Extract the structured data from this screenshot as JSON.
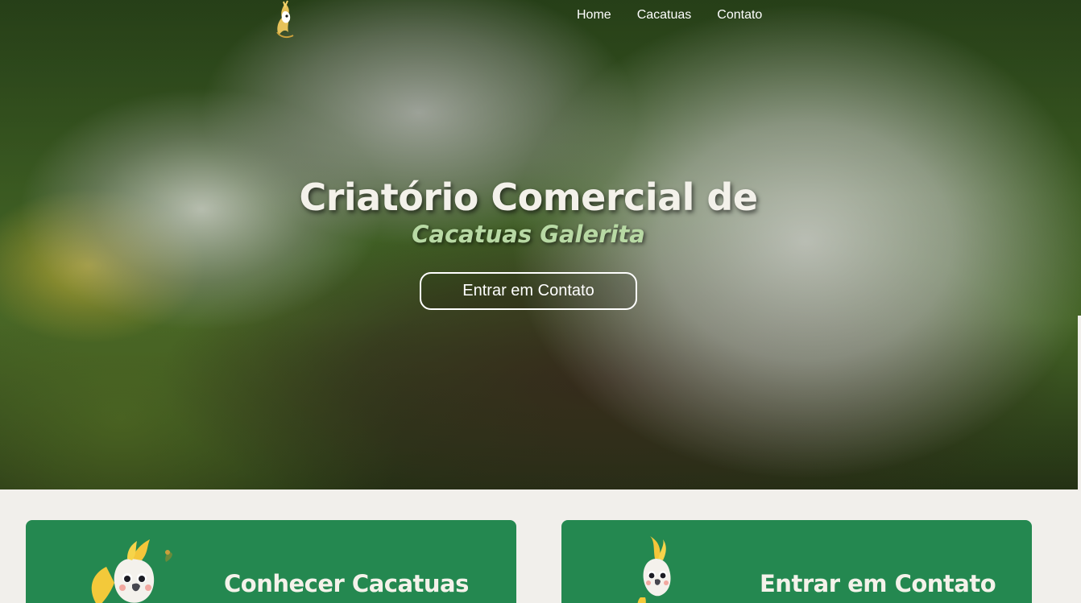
{
  "nav": {
    "items": [
      {
        "label": "Home"
      },
      {
        "label": "Cacatuas"
      },
      {
        "label": "Contato"
      }
    ]
  },
  "hero": {
    "title": "Criatório Comercial de",
    "subtitle": "Cacatuas Galerita",
    "cta_label": "Entrar em Contato"
  },
  "cards": [
    {
      "title": "Conhecer Cacatuas"
    },
    {
      "title": "Entrar em Contato"
    }
  ],
  "colors": {
    "accent_green": "#248850",
    "subtitle_green": "#b8d9a4",
    "page_background": "#f1efeb"
  },
  "icons": {
    "logo": "cockatoo-logo-icon",
    "mascot_1": "cockatoo-mascot-waving-icon",
    "mascot_2": "cockatoo-mascot-standing-icon"
  }
}
